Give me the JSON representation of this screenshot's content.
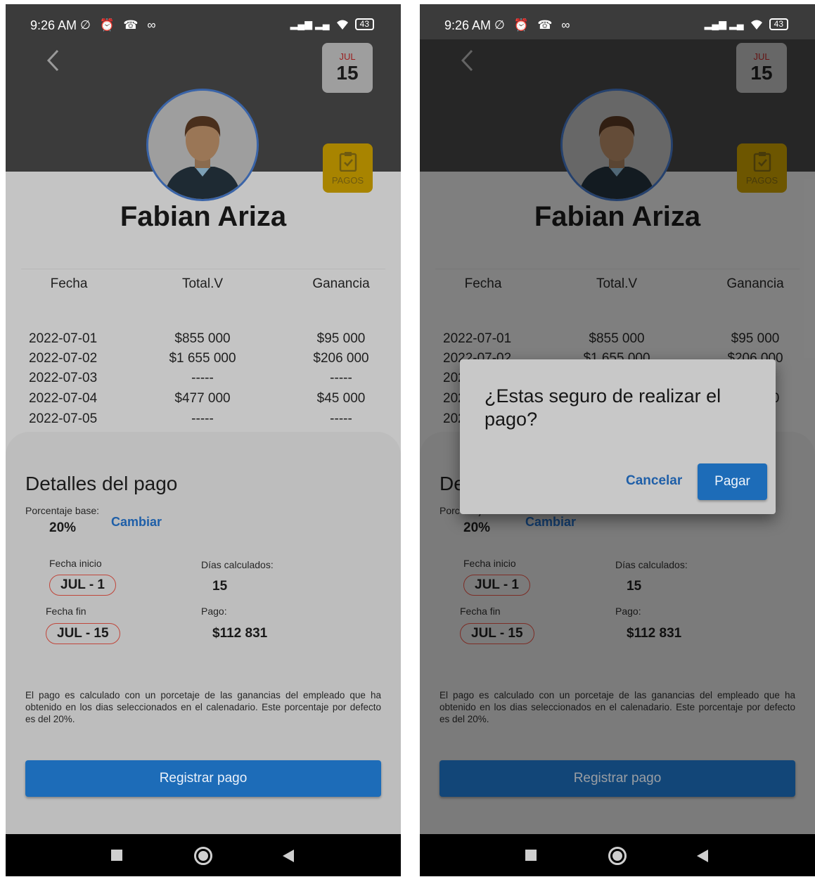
{
  "status_bar": {
    "time": "9:26 AM",
    "notification_icons": "∅ ⏰ ☎ ∞",
    "signal": "▂▄▆ ▂▄",
    "battery": "43"
  },
  "header": {
    "calendar_month": "JUL",
    "calendar_day": "15",
    "pagos_label": "PAGOS",
    "employee_name": "Fabian Ariza"
  },
  "table": {
    "headers": [
      "Fecha",
      "Total.V",
      "Ganancia"
    ],
    "rows": [
      {
        "fecha": "2022-07-01",
        "total": "$855 000",
        "ganancia": "$95 000"
      },
      {
        "fecha": "2022-07-02",
        "total": "$1 655 000",
        "ganancia": "$206 000"
      },
      {
        "fecha": "2022-07-03",
        "total": "-----",
        "ganancia": "-----"
      },
      {
        "fecha": "2022-07-04",
        "total": "$477 000",
        "ganancia": "$45 000"
      },
      {
        "fecha": "2022-07-05",
        "total": "-----",
        "ganancia": "-----"
      }
    ]
  },
  "sheet": {
    "title": "Detalles del pago",
    "base_label": "Porcentaje base:",
    "base_value": "20%",
    "change_label": "Cambiar",
    "start_label": "Fecha inicio",
    "start_value": "JUL - 1",
    "end_label": "Fecha fin",
    "end_value": "JUL - 15",
    "days_label": "Días calculados:",
    "days_value": "15",
    "pay_label": "Pago:",
    "pay_value": "$112 831",
    "note": "El pago es calculado con un porcetaje de las ganancias del empleado que ha obtenido en los dias seleccionados en el calenadario. Este porcentaje por defecto es del 20%.",
    "register_button": "Registrar pago"
  },
  "dialog": {
    "title": "¿Estas seguro de realizar el pago?",
    "cancel": "Cancelar",
    "confirm": "Pagar"
  },
  "colors": {
    "accent_blue": "#1d6cb8",
    "link_blue": "#1f5fa8",
    "pagos_yellow": "#f0c000",
    "chip_border": "#c0463b"
  }
}
